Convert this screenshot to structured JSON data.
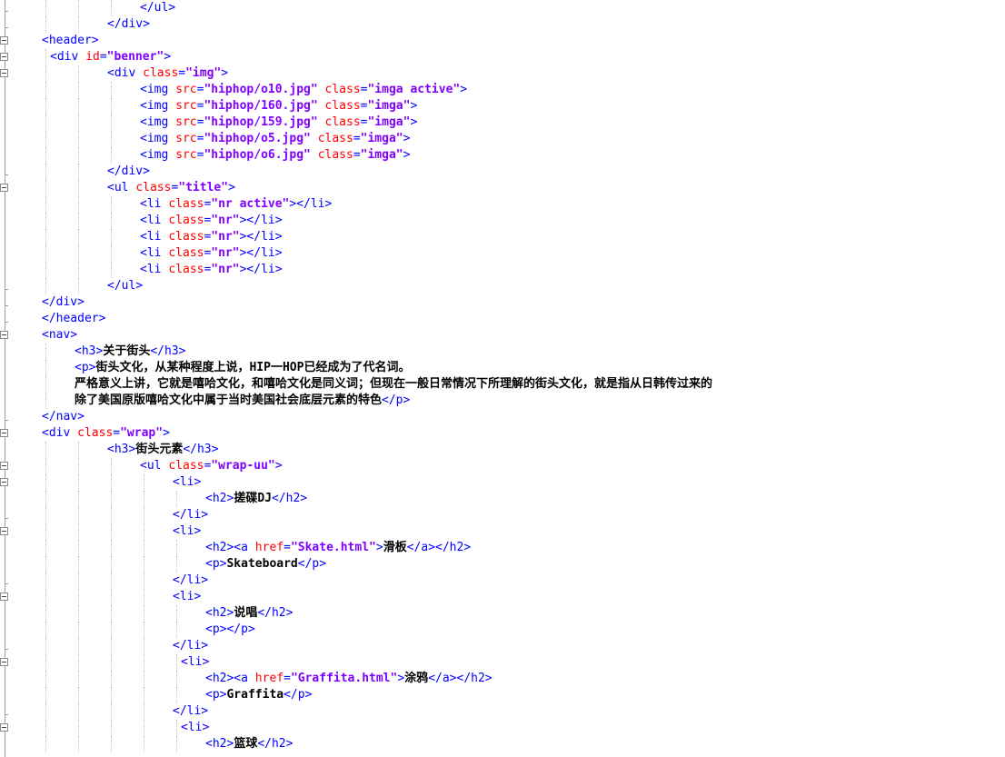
{
  "editor": {
    "lines": [
      {
        "indent": 154,
        "tokens": [
          {
            "k": "tag",
            "t": "</ul>"
          }
        ]
      },
      {
        "indent": 118,
        "tokens": [
          {
            "k": "tag",
            "t": "</div>"
          }
        ]
      },
      {
        "indent": 46,
        "tokens": [
          {
            "k": "tag",
            "t": "<header>"
          }
        ]
      },
      {
        "indent": 55,
        "tokens": [
          {
            "k": "tag",
            "t": "<div "
          },
          {
            "k": "attr",
            "t": "id"
          },
          {
            "k": "tag",
            "t": "="
          },
          {
            "k": "val",
            "t": "\"benner\""
          },
          {
            "k": "tag",
            "t": ">"
          }
        ]
      },
      {
        "indent": 118,
        "tokens": [
          {
            "k": "tag",
            "t": "<div "
          },
          {
            "k": "attr",
            "t": "class"
          },
          {
            "k": "tag",
            "t": "="
          },
          {
            "k": "val",
            "t": "\"img\""
          },
          {
            "k": "tag",
            "t": ">"
          }
        ]
      },
      {
        "indent": 154,
        "tokens": [
          {
            "k": "tag",
            "t": "<img "
          },
          {
            "k": "attr",
            "t": "src"
          },
          {
            "k": "tag",
            "t": "="
          },
          {
            "k": "val",
            "t": "\"hiphop/o10.jpg\""
          },
          {
            "k": "tag",
            "t": " "
          },
          {
            "k": "attr",
            "t": "class"
          },
          {
            "k": "tag",
            "t": "="
          },
          {
            "k": "val",
            "t": "\"imga active\""
          },
          {
            "k": "tag",
            "t": ">"
          }
        ]
      },
      {
        "indent": 154,
        "tokens": [
          {
            "k": "tag",
            "t": "<img "
          },
          {
            "k": "attr",
            "t": "src"
          },
          {
            "k": "tag",
            "t": "="
          },
          {
            "k": "val",
            "t": "\"hiphop/160.jpg\""
          },
          {
            "k": "tag",
            "t": " "
          },
          {
            "k": "attr",
            "t": "class"
          },
          {
            "k": "tag",
            "t": "="
          },
          {
            "k": "val",
            "t": "\"imga\""
          },
          {
            "k": "tag",
            "t": ">"
          }
        ]
      },
      {
        "indent": 154,
        "tokens": [
          {
            "k": "tag",
            "t": "<img "
          },
          {
            "k": "attr",
            "t": "src"
          },
          {
            "k": "tag",
            "t": "="
          },
          {
            "k": "val",
            "t": "\"hiphop/159.jpg\""
          },
          {
            "k": "tag",
            "t": " "
          },
          {
            "k": "attr",
            "t": "class"
          },
          {
            "k": "tag",
            "t": "="
          },
          {
            "k": "val",
            "t": "\"imga\""
          },
          {
            "k": "tag",
            "t": ">"
          }
        ]
      },
      {
        "indent": 154,
        "tokens": [
          {
            "k": "tag",
            "t": "<img "
          },
          {
            "k": "attr",
            "t": "src"
          },
          {
            "k": "tag",
            "t": "="
          },
          {
            "k": "val",
            "t": "\"hiphop/o5.jpg\""
          },
          {
            "k": "tag",
            "t": " "
          },
          {
            "k": "attr",
            "t": "class"
          },
          {
            "k": "tag",
            "t": "="
          },
          {
            "k": "val",
            "t": "\"imga\""
          },
          {
            "k": "tag",
            "t": ">"
          }
        ]
      },
      {
        "indent": 154,
        "tokens": [
          {
            "k": "tag",
            "t": "<img "
          },
          {
            "k": "attr",
            "t": "src"
          },
          {
            "k": "tag",
            "t": "="
          },
          {
            "k": "val",
            "t": "\"hiphop/o6.jpg\""
          },
          {
            "k": "tag",
            "t": " "
          },
          {
            "k": "attr",
            "t": "class"
          },
          {
            "k": "tag",
            "t": "="
          },
          {
            "k": "val",
            "t": "\"imga\""
          },
          {
            "k": "tag",
            "t": ">"
          }
        ]
      },
      {
        "indent": 118,
        "tokens": [
          {
            "k": "tag",
            "t": "</div>"
          }
        ]
      },
      {
        "indent": 118,
        "tokens": [
          {
            "k": "tag",
            "t": "<ul "
          },
          {
            "k": "attr",
            "t": "class"
          },
          {
            "k": "tag",
            "t": "="
          },
          {
            "k": "val",
            "t": "\"title\""
          },
          {
            "k": "tag",
            "t": ">"
          }
        ]
      },
      {
        "indent": 154,
        "tokens": [
          {
            "k": "tag",
            "t": "<li "
          },
          {
            "k": "attr",
            "t": "class"
          },
          {
            "k": "tag",
            "t": "="
          },
          {
            "k": "val",
            "t": "\"nr active\""
          },
          {
            "k": "tag",
            "t": "></li>"
          }
        ]
      },
      {
        "indent": 154,
        "tokens": [
          {
            "k": "tag",
            "t": "<li "
          },
          {
            "k": "attr",
            "t": "class"
          },
          {
            "k": "tag",
            "t": "="
          },
          {
            "k": "val",
            "t": "\"nr\""
          },
          {
            "k": "tag",
            "t": "></li>"
          }
        ]
      },
      {
        "indent": 154,
        "tokens": [
          {
            "k": "tag",
            "t": "<li "
          },
          {
            "k": "attr",
            "t": "class"
          },
          {
            "k": "tag",
            "t": "="
          },
          {
            "k": "val",
            "t": "\"nr\""
          },
          {
            "k": "tag",
            "t": "></li>"
          }
        ]
      },
      {
        "indent": 154,
        "tokens": [
          {
            "k": "tag",
            "t": "<li "
          },
          {
            "k": "attr",
            "t": "class"
          },
          {
            "k": "tag",
            "t": "="
          },
          {
            "k": "val",
            "t": "\"nr\""
          },
          {
            "k": "tag",
            "t": "></li>"
          }
        ]
      },
      {
        "indent": 154,
        "tokens": [
          {
            "k": "tag",
            "t": "<li "
          },
          {
            "k": "attr",
            "t": "class"
          },
          {
            "k": "tag",
            "t": "="
          },
          {
            "k": "val",
            "t": "\"nr\""
          },
          {
            "k": "tag",
            "t": "></li>"
          }
        ]
      },
      {
        "indent": 118,
        "tokens": [
          {
            "k": "tag",
            "t": "</ul>"
          }
        ]
      },
      {
        "indent": 46,
        "tokens": [
          {
            "k": "tag",
            "t": "</div>"
          }
        ]
      },
      {
        "indent": 46,
        "tokens": [
          {
            "k": "tag",
            "t": "</header>"
          }
        ]
      },
      {
        "indent": 46,
        "tokens": [
          {
            "k": "tag",
            "t": "<nav>"
          }
        ]
      },
      {
        "indent": 82,
        "tokens": [
          {
            "k": "tag",
            "t": "<h3>"
          },
          {
            "k": "text",
            "t": "关于街头"
          },
          {
            "k": "tag",
            "t": "</h3>"
          }
        ]
      },
      {
        "indent": 82,
        "tokens": [
          {
            "k": "tag",
            "t": "<p>"
          },
          {
            "k": "text",
            "t": "街头文化，从某种程度上说，HIP一HOP已经成为了代名词。"
          }
        ]
      },
      {
        "indent": 82,
        "tokens": [
          {
            "k": "text",
            "t": "严格意义上讲，它就是嘻哈文化，和嘻哈文化是同义词；但现在一般日常情况下所理解的街头文化，就是指从日韩传过来的"
          }
        ]
      },
      {
        "indent": 82,
        "tokens": [
          {
            "k": "text",
            "t": "除了美国原版嘻哈文化中属于当时美国社会底层元素的特色"
          },
          {
            "k": "tag",
            "t": "</p>"
          }
        ]
      },
      {
        "indent": 46,
        "tokens": [
          {
            "k": "tag",
            "t": "</nav>"
          }
        ]
      },
      {
        "indent": 46,
        "tokens": [
          {
            "k": "tag",
            "t": "<div "
          },
          {
            "k": "attr",
            "t": "class"
          },
          {
            "k": "tag",
            "t": "="
          },
          {
            "k": "val",
            "t": "\"wrap\""
          },
          {
            "k": "tag",
            "t": ">"
          }
        ]
      },
      {
        "indent": 118,
        "tokens": [
          {
            "k": "tag",
            "t": "<h3>"
          },
          {
            "k": "text",
            "t": "街头元素"
          },
          {
            "k": "tag",
            "t": "</h3>"
          }
        ]
      },
      {
        "indent": 154,
        "tokens": [
          {
            "k": "tag",
            "t": "<ul "
          },
          {
            "k": "attr",
            "t": "class"
          },
          {
            "k": "tag",
            "t": "="
          },
          {
            "k": "val",
            "t": "\"wrap-uu\""
          },
          {
            "k": "tag",
            "t": ">"
          }
        ]
      },
      {
        "indent": 190,
        "tokens": [
          {
            "k": "tag",
            "t": "<li>"
          }
        ]
      },
      {
        "indent": 226,
        "tokens": [
          {
            "k": "tag",
            "t": "<h2>"
          },
          {
            "k": "text",
            "t": "搓碟DJ"
          },
          {
            "k": "tag",
            "t": "</h2>"
          }
        ]
      },
      {
        "indent": 190,
        "tokens": [
          {
            "k": "tag",
            "t": "</li>"
          }
        ]
      },
      {
        "indent": 190,
        "tokens": [
          {
            "k": "tag",
            "t": "<li>"
          }
        ]
      },
      {
        "indent": 226,
        "tokens": [
          {
            "k": "tag",
            "t": "<h2><a "
          },
          {
            "k": "attr",
            "t": "href"
          },
          {
            "k": "tag",
            "t": "="
          },
          {
            "k": "val",
            "t": "\"Skate.html\""
          },
          {
            "k": "tag",
            "t": ">"
          },
          {
            "k": "text",
            "t": "滑板"
          },
          {
            "k": "tag",
            "t": "</a></h2>"
          }
        ]
      },
      {
        "indent": 226,
        "tokens": [
          {
            "k": "tag",
            "t": "<p>"
          },
          {
            "k": "text",
            "t": "Skateboard"
          },
          {
            "k": "tag",
            "t": "</p>"
          }
        ]
      },
      {
        "indent": 190,
        "tokens": [
          {
            "k": "tag",
            "t": "</li>"
          }
        ]
      },
      {
        "indent": 190,
        "tokens": [
          {
            "k": "tag",
            "t": "<li>"
          }
        ]
      },
      {
        "indent": 226,
        "tokens": [
          {
            "k": "tag",
            "t": "<h2>"
          },
          {
            "k": "text",
            "t": "说唱"
          },
          {
            "k": "tag",
            "t": "</h2>"
          }
        ]
      },
      {
        "indent": 226,
        "tokens": [
          {
            "k": "tag",
            "t": "<p></p>"
          }
        ]
      },
      {
        "indent": 190,
        "tokens": [
          {
            "k": "tag",
            "t": "</li>"
          }
        ]
      },
      {
        "indent": 199,
        "tokens": [
          {
            "k": "tag",
            "t": "<li>"
          }
        ]
      },
      {
        "indent": 226,
        "tokens": [
          {
            "k": "tag",
            "t": "<h2><a "
          },
          {
            "k": "attr",
            "t": "href"
          },
          {
            "k": "tag",
            "t": "="
          },
          {
            "k": "val",
            "t": "\"Graffita.html\""
          },
          {
            "k": "tag",
            "t": ">"
          },
          {
            "k": "text",
            "t": "涂鸦"
          },
          {
            "k": "tag",
            "t": "</a></h2>"
          }
        ]
      },
      {
        "indent": 226,
        "tokens": [
          {
            "k": "tag",
            "t": "<p>"
          },
          {
            "k": "text",
            "t": "Graffita"
          },
          {
            "k": "tag",
            "t": "</p>"
          }
        ]
      },
      {
        "indent": 190,
        "tokens": [
          {
            "k": "tag",
            "t": "</li>"
          }
        ]
      },
      {
        "indent": 199,
        "tokens": [
          {
            "k": "tag",
            "t": "<li>"
          }
        ]
      },
      {
        "indent": 226,
        "tokens": [
          {
            "k": "tag",
            "t": "<h2>"
          },
          {
            "k": "text",
            "t": "篮球"
          },
          {
            "k": "tag",
            "t": "</h2>"
          }
        ]
      }
    ],
    "fold_markers": [
      {
        "line": 2,
        "type": "box"
      },
      {
        "line": 3,
        "type": "box"
      },
      {
        "line": 4,
        "type": "box"
      },
      {
        "line": 11,
        "type": "box"
      },
      {
        "line": 20,
        "type": "box"
      },
      {
        "line": 26,
        "type": "box"
      },
      {
        "line": 28,
        "type": "box"
      },
      {
        "line": 29,
        "type": "box"
      },
      {
        "line": 32,
        "type": "box"
      },
      {
        "line": 36,
        "type": "box"
      },
      {
        "line": 40,
        "type": "box"
      },
      {
        "line": 44,
        "type": "box"
      }
    ],
    "colors": {
      "tag": "#0000ff",
      "attr": "#ff0000",
      "value": "#8000ff",
      "text": "#000000"
    }
  }
}
